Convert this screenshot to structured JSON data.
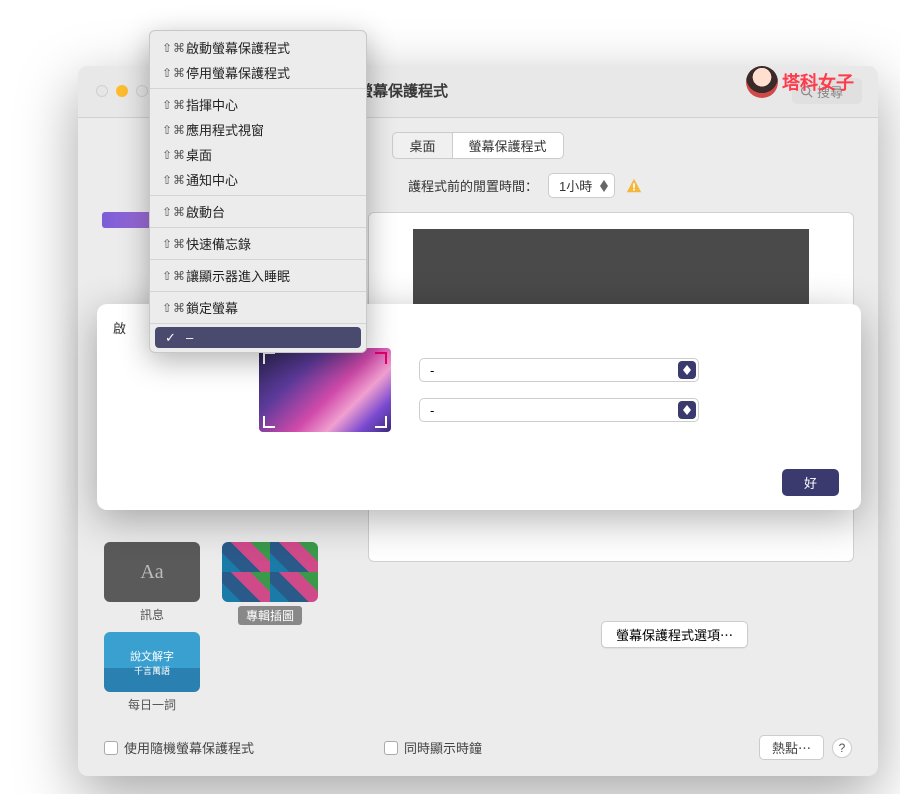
{
  "window": {
    "title_suffix": "螢幕保護程式",
    "search_placeholder": "搜尋"
  },
  "tabs": {
    "desktop": "桌面",
    "screensaver": "螢幕保護程式"
  },
  "idle": {
    "label": "護程式前的閒置時間：",
    "value": "1小時"
  },
  "sheet": {
    "left_label": "啟",
    "select1": "-",
    "select2": "-",
    "ok": "好"
  },
  "grid": {
    "msg_thumb": "Aa",
    "msg_label": "訊息",
    "album_label": "專輯插圖",
    "word_line1": "說文解字",
    "word_line2": "千言萬語",
    "word_label": "每日一詞"
  },
  "options_btn": "螢幕保護程式選項⋯",
  "footer": {
    "random": "使用隨機螢幕保護程式",
    "clock": "同時顯示時鐘",
    "hotcorners": "熱點⋯",
    "help": "?"
  },
  "menu": {
    "shortcut": "⇧⌘",
    "items": [
      "啟動螢幕保護程式",
      "停用螢幕保護程式",
      "指揮中心",
      "應用程式視窗",
      "桌面",
      "通知中心",
      "啟動台",
      "快速備忘錄",
      "讓顯示器進入睡眠",
      "鎖定螢幕"
    ],
    "selected": "–"
  },
  "brand": "塔科女子"
}
